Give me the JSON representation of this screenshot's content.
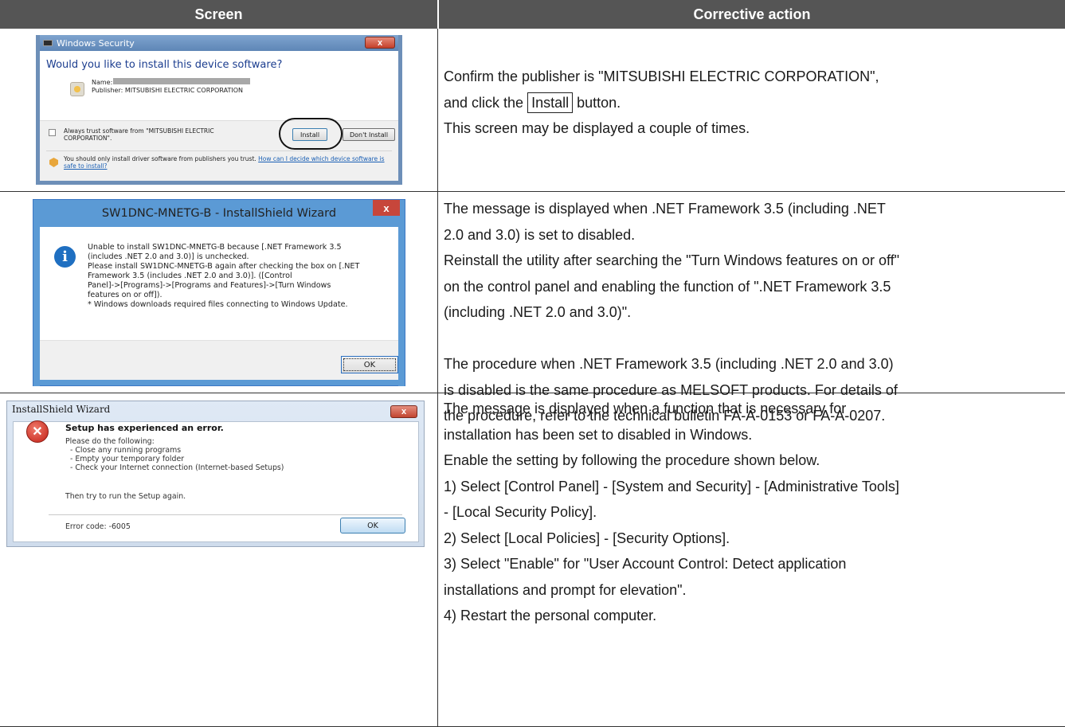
{
  "header": {
    "screen": "Screen",
    "action": "Corrective action"
  },
  "rows": [
    {
      "dialog": {
        "title": "Windows Security",
        "close": "x",
        "question": "Would you like to install this device software?",
        "name_label": "Name:",
        "publisher": "Publisher: MITSUBISHI ELECTRIC CORPORATION",
        "always_trust_1": "Always trust software from \"MITSUBISHI ELECTRIC",
        "always_trust_2": "CORPORATION\".",
        "install": "Install",
        "dont_install": "Don't Install",
        "note_1": "You should only install driver software from publishers you trust.",
        "note_link": "How can I decide which device software is safe to install?"
      },
      "action": {
        "line1": "Confirm the publisher is \"MITSUBISHI ELECTRIC CORPORATION\",",
        "line2_pre": "and click the",
        "line2_btn": "Install",
        "line2_post": "button.",
        "line3": "This screen may be displayed a couple of times."
      }
    },
    {
      "dialog": {
        "title": "SW1DNC-MNETG-B - InstallShield Wizard",
        "close": "x",
        "msg_1": "Unable to install SW1DNC-MNETG-B because [.NET Framework 3.5",
        "msg_2": "(includes .NET 2.0 and 3.0)] is unchecked.",
        "msg_3": "Please install SW1DNC-MNETG-B again after checking the box on [.NET",
        "msg_4": "Framework 3.5 (includes .NET 2.0 and 3.0)]. ([Control",
        "msg_5": "Panel]->[Programs]->[Programs and Features]->[Turn Windows",
        "msg_6": "features on or off]).",
        "msg_7": "* Windows downloads required files connecting to Windows Update.",
        "ok": "OK"
      },
      "action": [
        "The message is displayed when .NET Framework 3.5 (including .NET",
        "2.0 and 3.0) is set to disabled.",
        "Reinstall the utility after searching the \"Turn Windows features on or off\"",
        "on the control panel and enabling the function of \".NET Framework 3.5",
        "(including .NET 2.0 and 3.0)\".",
        "",
        "The procedure when .NET Framework 3.5 (including .NET 2.0 and 3.0)",
        "is disabled is the same procedure as MELSOFT products. For details of",
        "the procedure, refer to the technical bulletin FA-A-0153 or FA-A-0207."
      ]
    },
    {
      "dialog": {
        "title": "InstallShield Wizard",
        "close": "x",
        "heading": "Setup has experienced an error.",
        "please": "Please do the following:",
        "item_1": "- Close any running programs",
        "item_2": "- Empty your temporary folder",
        "item_3": "- Check your Internet connection (Internet-based Setups)",
        "then": "Then try to run the Setup again.",
        "error_code": "Error code:  -6005",
        "ok": "OK"
      },
      "action": [
        "The message is displayed when a function that is necessary for",
        "installation has been set to disabled in Windows.",
        "Enable the setting by following the procedure shown below.",
        "1) Select [Control Panel] - [System and Security] - [Administrative Tools]",
        "- [Local Security Policy].",
        "2) Select [Local Policies] - [Security Options].",
        "3) Select \"Enable\" for \"User Account Control: Detect application",
        "installations and prompt for elevation\".",
        "4) Restart the personal computer."
      ]
    }
  ]
}
